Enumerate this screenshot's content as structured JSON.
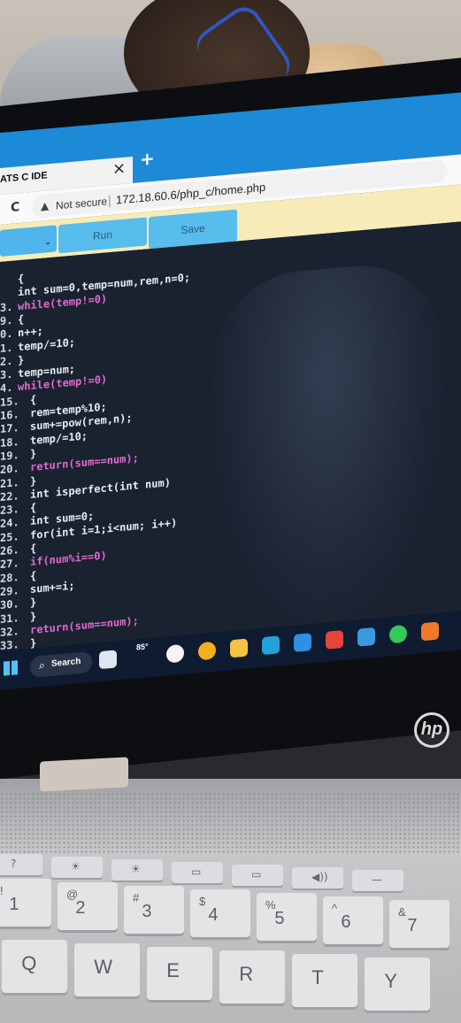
{
  "browser": {
    "tab_title": "ATS C IDE",
    "tab_close": "×",
    "new_tab": "+",
    "reload": "C",
    "warning": "▲",
    "not_secure": "Not secure",
    "separator": "|",
    "url": "172.18.60.6/php_c/home.php"
  },
  "toolbar": {
    "select_chevron": "⌄",
    "run_label": "Run",
    "save_label": "Save"
  },
  "editor": {
    "lines": [
      {
        "num": "",
        "text": "{",
        "kw": false
      },
      {
        "num": "",
        "text": "int sum=0,temp=num,rem,n=0;",
        "kw": false
      },
      {
        "num": "3.",
        "text": "while(temp!=0)",
        "kw": true
      },
      {
        "num": "9.",
        "text": "{",
        "kw": false
      },
      {
        "num": "0.",
        "text": "n++;",
        "kw": false
      },
      {
        "num": "1.",
        "text": "temp/=10;",
        "kw": false
      },
      {
        "num": "2.",
        "text": "}",
        "kw": false
      },
      {
        "num": "3.",
        "text": "temp=num;",
        "kw": false
      },
      {
        "num": "4.",
        "text": "while(temp!=0)",
        "kw": true
      },
      {
        "num": "15.",
        "text": "{",
        "kw": false
      },
      {
        "num": "16.",
        "text": "rem=temp%10;",
        "kw": false
      },
      {
        "num": "17.",
        "text": "sum+=pow(rem,n);",
        "kw": false
      },
      {
        "num": "18.",
        "text": "temp/=10;",
        "kw": false
      },
      {
        "num": "19.",
        "text": "}",
        "kw": false
      },
      {
        "num": "20.",
        "text": "return(sum==num);",
        "kw": true
      },
      {
        "num": "21.",
        "text": "}",
        "kw": false
      },
      {
        "num": "22.",
        "text": "int isperfect(int num)",
        "kw": false
      },
      {
        "num": "23.",
        "text": "{",
        "kw": false
      },
      {
        "num": "24.",
        "text": "int sum=0;",
        "kw": false
      },
      {
        "num": "25.",
        "text": "for(int i=1;i<num; i++)",
        "kw": false
      },
      {
        "num": "26.",
        "text": "{",
        "kw": false
      },
      {
        "num": "27.",
        "text": "if(num%i==0)",
        "kw": true
      },
      {
        "num": "28.",
        "text": "{",
        "kw": false
      },
      {
        "num": "29.",
        "text": "sum+=i;",
        "kw": false
      },
      {
        "num": "30.",
        "text": "}",
        "kw": false
      },
      {
        "num": "31.",
        "text": "}",
        "kw": false
      },
      {
        "num": "32.",
        "text": "return(sum==num);",
        "kw": true
      },
      {
        "num": "33.",
        "text": "}",
        "kw": false
      }
    ]
  },
  "taskbar": {
    "search_icon": "⌕",
    "search_label": "Search",
    "temperature": "85°",
    "apps": [
      {
        "name": "task-view-icon",
        "color": "#dfe6f0"
      },
      {
        "name": "chat-icon",
        "color": "#f4f4f4"
      },
      {
        "name": "chrome-icon",
        "color": "#f2b01e"
      },
      {
        "name": "file-explorer-icon",
        "color": "#f5c242"
      },
      {
        "name": "edge-icon",
        "color": "#1fa3d8"
      },
      {
        "name": "store-icon",
        "color": "#2f8fe0"
      },
      {
        "name": "chrome-profile-icon",
        "color": "#e3453a"
      },
      {
        "name": "app-icon",
        "color": "#3a9ae0"
      },
      {
        "name": "whatsapp-icon",
        "color": "#35c95a"
      },
      {
        "name": "notification-app-icon",
        "color": "#f07a2a"
      }
    ]
  },
  "laptop": {
    "brand": "hp"
  },
  "keyboard": {
    "number_row": [
      {
        "top": "!",
        "main": "1"
      },
      {
        "top": "@",
        "main": "2"
      },
      {
        "top": "#",
        "main": "3"
      },
      {
        "top": "$",
        "main": "4"
      },
      {
        "top": "%",
        "main": "5"
      },
      {
        "top": "^",
        "main": "6"
      },
      {
        "top": "&",
        "main": "7"
      }
    ],
    "letter_row": [
      "Q",
      "W",
      "E",
      "R",
      "T",
      "Y"
    ],
    "fn_row": [
      "?",
      "☀",
      "☀",
      "▭",
      "▭",
      "◀))",
      "—"
    ]
  }
}
